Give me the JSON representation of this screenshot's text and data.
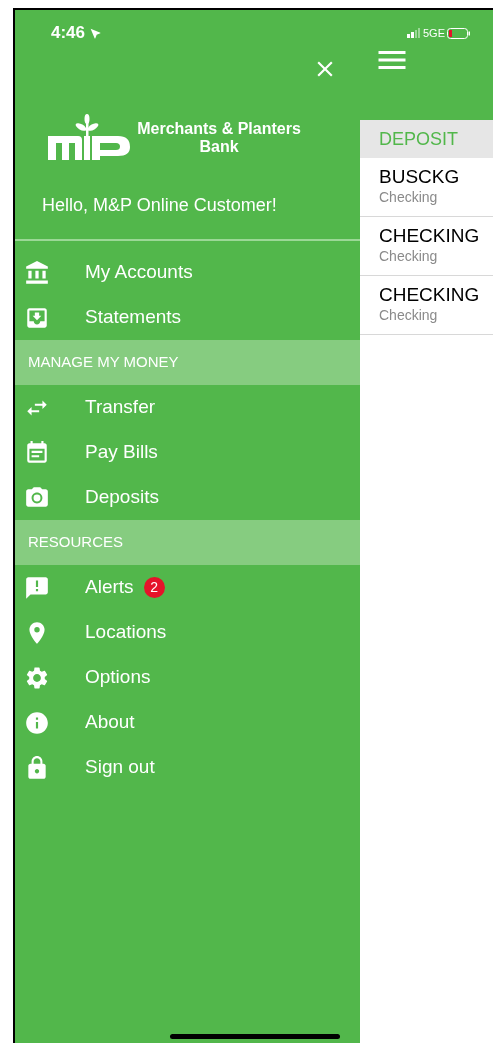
{
  "status_bar": {
    "time": "4:46",
    "network": "5GE"
  },
  "drawer": {
    "bank_name": "Merchants & Planters Bank",
    "greeting": "Hello, M&P Online Customer!",
    "menu": [
      {
        "kind": "link",
        "label": "My Accounts"
      },
      {
        "kind": "link",
        "label": "Statements"
      },
      {
        "kind": "header",
        "label": "MANAGE MY MONEY"
      },
      {
        "kind": "link",
        "label": "Transfer"
      },
      {
        "kind": "link",
        "label": "Pay Bills"
      },
      {
        "kind": "link",
        "label": "Deposits"
      },
      {
        "kind": "header",
        "label": "RESOURCES"
      },
      {
        "kind": "link",
        "label": "Alerts",
        "badge": "2"
      },
      {
        "kind": "link",
        "label": "Locations"
      },
      {
        "kind": "link",
        "label": "Options"
      },
      {
        "kind": "link",
        "label": "About"
      },
      {
        "kind": "link",
        "label": "Sign out"
      }
    ]
  },
  "accounts": {
    "section": "DEPOSIT",
    "rows": [
      {
        "name": "BUSCKG",
        "type": "Checking"
      },
      {
        "name": "CHECKING",
        "type": "Checking"
      },
      {
        "name": "CHECKING",
        "type": "Checking"
      }
    ]
  }
}
